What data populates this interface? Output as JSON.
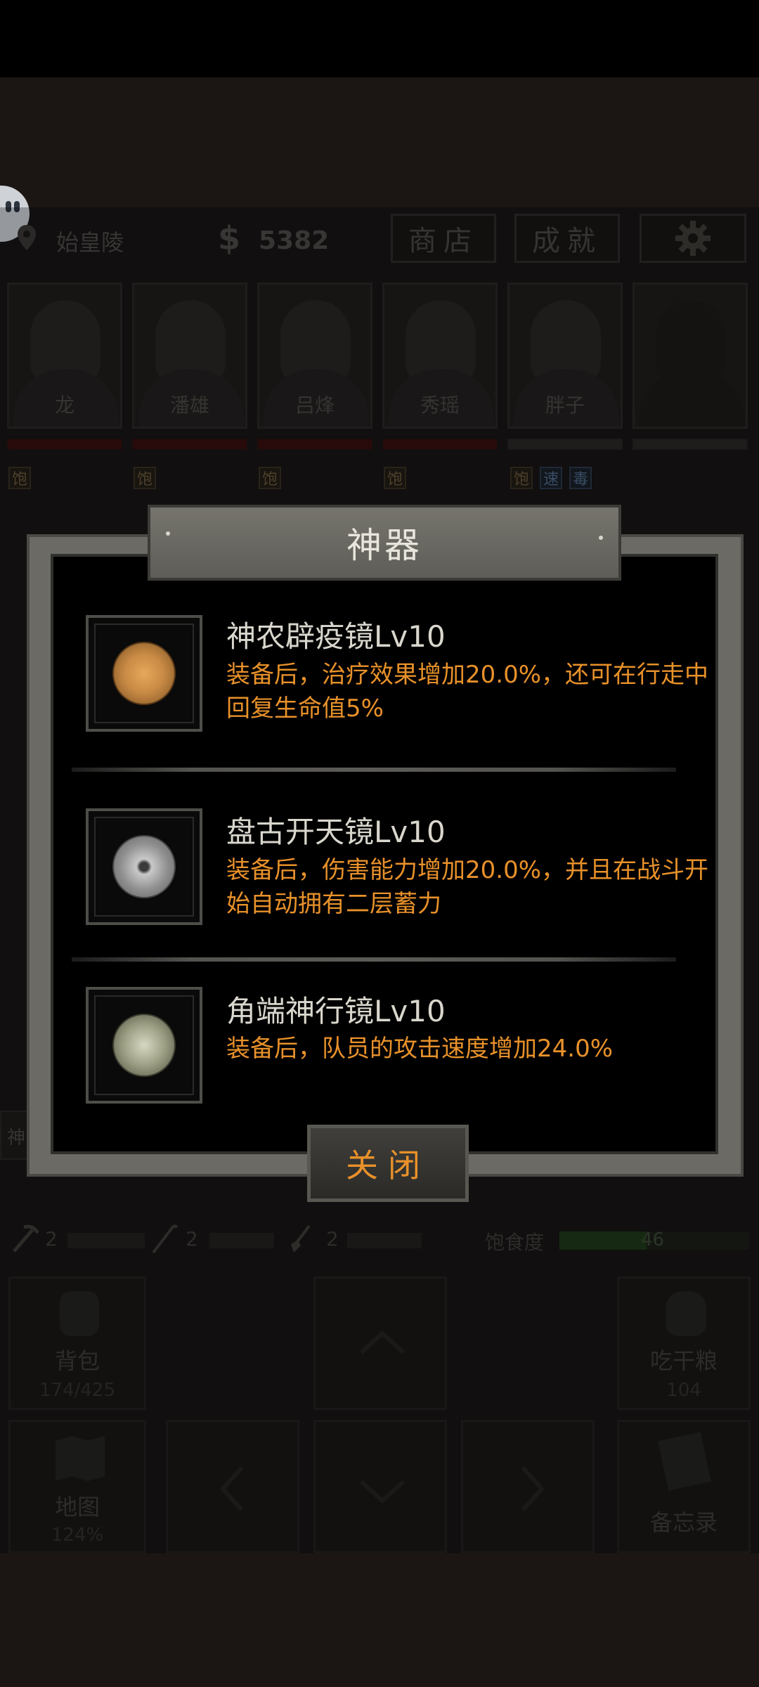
{
  "header": {
    "location": "始皇陵",
    "currency_symbol": "$",
    "money": "5382",
    "shop_label": "商店",
    "achievements_label": "成就"
  },
  "party": [
    {
      "name": "龙",
      "status": [
        "饱"
      ]
    },
    {
      "name": "潘雄",
      "status": [
        "饱"
      ]
    },
    {
      "name": "吕烽",
      "status": [
        "饱"
      ]
    },
    {
      "name": "秀瑶",
      "status": [
        "饱"
      ]
    },
    {
      "name": "胖子",
      "status": [
        "饱",
        "速",
        "毒"
      ]
    },
    {
      "name": "",
      "status": []
    }
  ],
  "tools": [
    {
      "icon": "pickaxe-icon",
      "count": "2"
    },
    {
      "icon": "hook-icon",
      "count": "2"
    },
    {
      "icon": "shovel-icon",
      "count": "2"
    }
  ],
  "satiety": {
    "label": "饱食度",
    "value": "46"
  },
  "side_tab": "神",
  "actions": {
    "backpack": {
      "label": "背包",
      "sub": "174/425"
    },
    "eat": {
      "label": "吃干粮",
      "sub": "104"
    },
    "map": {
      "label": "地图",
      "sub": "124%"
    },
    "memo": {
      "label": "备忘录"
    }
  },
  "modal": {
    "title": "神器",
    "close_label": "关闭",
    "artifacts": [
      {
        "name": "神农辟疫镜Lv10",
        "desc": "装备后，治疗效果增加20.0%，还可在行走中回复生命值5%",
        "coin_color": "#c98b45"
      },
      {
        "name": "盘古开天镜Lv10",
        "desc": "装备后，伤害能力增加20.0%，并且在战斗开始自动拥有二层蓄力",
        "coin_color": "#a9a9a9"
      },
      {
        "name": "角端神行镜Lv10",
        "desc": "装备后，队员的攻击速度增加24.0%",
        "coin_color": "#9a9c82"
      }
    ]
  },
  "colors": {
    "accent_orange": "#e8912a",
    "title_text": "#e8e5dc"
  }
}
